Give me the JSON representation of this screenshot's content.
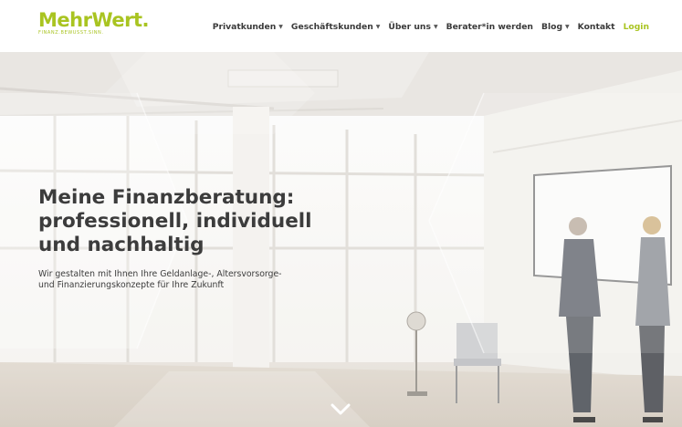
{
  "header": {
    "logo_text": "MehrWert.",
    "logo_tagline": "FINANZ.BEWUSST.SINN.",
    "brand_color": "#a9c421"
  },
  "nav": {
    "items": [
      {
        "label": "Privatkunden",
        "has_dropdown": true
      },
      {
        "label": "Geschäftskunden",
        "has_dropdown": true
      },
      {
        "label": "Über uns",
        "has_dropdown": true
      },
      {
        "label": "Berater*in werden",
        "has_dropdown": false
      },
      {
        "label": "Blog",
        "has_dropdown": true
      },
      {
        "label": "Kontakt",
        "has_dropdown": false
      }
    ],
    "login_label": "Login",
    "dropdown_icon": "caret-down-icon"
  },
  "hero": {
    "headline_line1": "Meine Finanzberatung:",
    "headline_line2": "professionell, individuell",
    "headline_line3": "und nachhaltig",
    "subline_line1": "Wir gestalten mit Ihnen Ihre Geldanlage-, Altersvorsorge-",
    "subline_line2": "und Finanzierungskonzepte für Ihre Zukunft",
    "scroll_icon": "chevron-down-icon"
  }
}
